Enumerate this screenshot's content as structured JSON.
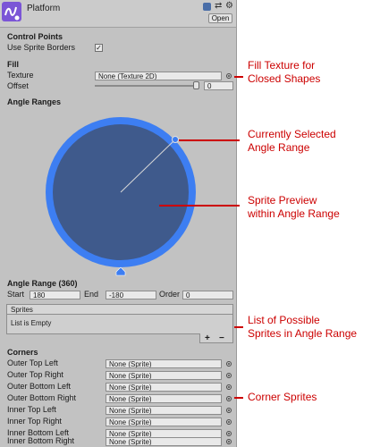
{
  "header": {
    "title": "Platform",
    "open_label": "Open"
  },
  "control_points": {
    "heading": "Control Points",
    "use_sprite_borders_label": "Use Sprite Borders",
    "use_sprite_borders_checked": true
  },
  "fill": {
    "heading": "Fill",
    "texture_label": "Texture",
    "texture_value": "None (Texture 2D)",
    "offset_label": "Offset",
    "offset_value": "0"
  },
  "angle_ranges": {
    "heading": "Angle Ranges"
  },
  "angle_range": {
    "heading": "Angle Range (360)",
    "start_label": "Start",
    "start_value": "180",
    "end_label": "End",
    "end_value": "-180",
    "order_label": "Order",
    "order_value": "0"
  },
  "sprites": {
    "heading": "Sprites",
    "empty_text": "List is Empty",
    "add_label": "+",
    "remove_label": "−"
  },
  "corners": {
    "heading": "Corners",
    "items": [
      {
        "label": "Outer Top Left",
        "value": "None (Sprite)"
      },
      {
        "label": "Outer Top Right",
        "value": "None (Sprite)"
      },
      {
        "label": "Outer Bottom Left",
        "value": "None (Sprite)"
      },
      {
        "label": "Outer Bottom Right",
        "value": "None (Sprite)"
      },
      {
        "label": "Inner Top Left",
        "value": "None (Sprite)"
      },
      {
        "label": "Inner Top Right",
        "value": "None (Sprite)"
      },
      {
        "label": "Inner Bottom Left",
        "value": "None (Sprite)"
      },
      {
        "label": "Inner Bottom Right",
        "value": "None (Sprite)"
      }
    ]
  },
  "annotations": {
    "fill_texture": [
      "Fill Texture for",
      "Closed Shapes"
    ],
    "selected_range": [
      "Currently Selected",
      "Angle Range"
    ],
    "sprite_preview": [
      "Sprite Preview",
      "within Angle Range"
    ],
    "possible_sprites": [
      "List of Possible",
      "Sprites in Angle Range"
    ],
    "corner_sprites": [
      "Corner Sprites"
    ]
  },
  "colors": {
    "panel": "#c2c2c2",
    "ring": "#3d7ef2",
    "disc": "#3f5a8c",
    "annotation": "#cc0000",
    "asset_icon": "#7b55d6"
  }
}
